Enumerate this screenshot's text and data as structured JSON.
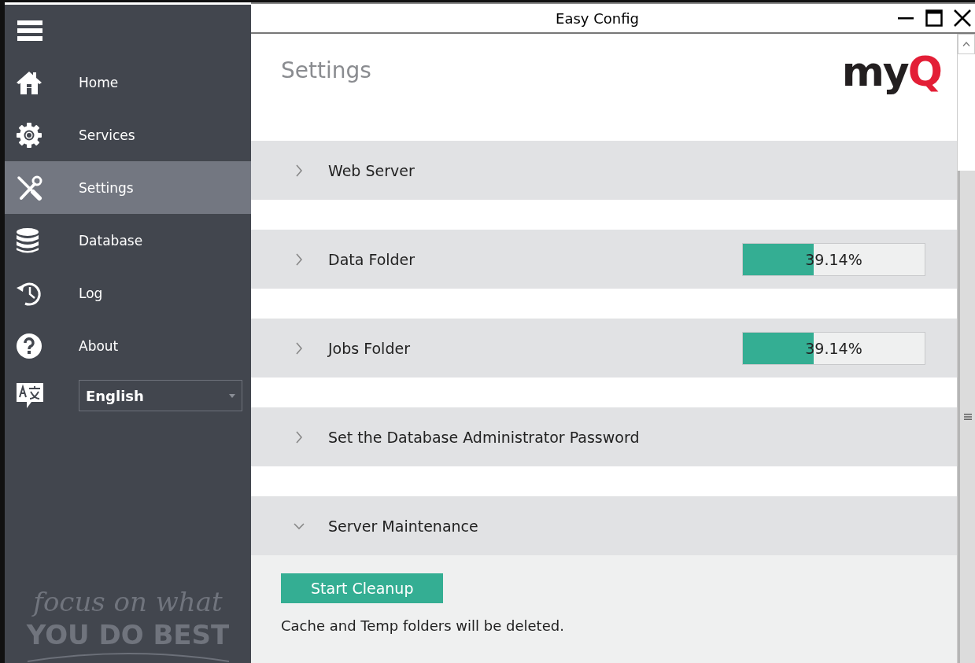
{
  "window": {
    "title": "Easy Config"
  },
  "sidebar": {
    "items": [
      {
        "label": "Home",
        "kind": "home",
        "selected": false
      },
      {
        "label": "Services",
        "kind": "gear",
        "selected": false
      },
      {
        "label": "Settings",
        "kind": "tools",
        "selected": true
      },
      {
        "label": "Database",
        "kind": "database",
        "selected": false
      },
      {
        "label": "Log",
        "kind": "history",
        "selected": false
      },
      {
        "label": "About",
        "kind": "help",
        "selected": false
      }
    ],
    "language": {
      "value": "English"
    },
    "tagline": {
      "line_1": "focus on what",
      "line_2": "YOU DO BEST"
    }
  },
  "page": {
    "title": "Settings",
    "logo": {
      "part_1": "my",
      "part_2": "Q"
    }
  },
  "sections": [
    {
      "title": "Web Server",
      "expanded": false
    },
    {
      "title": "Data Folder",
      "expanded": false,
      "progress": {
        "level": 0.39,
        "reading": "39.14%"
      }
    },
    {
      "title": "Jobs Folder",
      "expanded": false,
      "progress": {
        "level": 0.39,
        "reading": "39.14%"
      }
    },
    {
      "title": "Set the Database Administrator Password",
      "expanded": false
    },
    {
      "title": "Server Maintenance",
      "expanded": true,
      "button": "Start Cleanup",
      "note": "Cache and Temp folders will be deleted."
    }
  ]
}
